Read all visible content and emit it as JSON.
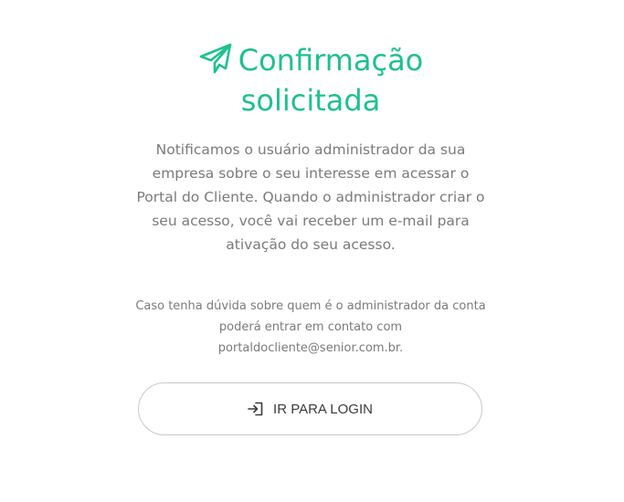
{
  "header": {
    "title": "Confirmação solicitada",
    "icon": "paper-plane-icon",
    "accent_color": "#1fc090"
  },
  "message": {
    "body": "Notificamos o usuário administrador da sua empresa sobre o seu interesse em acessar o Portal do Cliente. Quando o administrador criar o seu acesso, você vai receber um e-mail para ativação do seu acesso.",
    "contact_note": "Caso tenha dúvida sobre quem é o administrador da conta poderá entrar em contato com portaldocliente@senior.com.br."
  },
  "actions": {
    "login_label": "IR PARA LOGIN",
    "login_icon": "sign-in-icon"
  }
}
